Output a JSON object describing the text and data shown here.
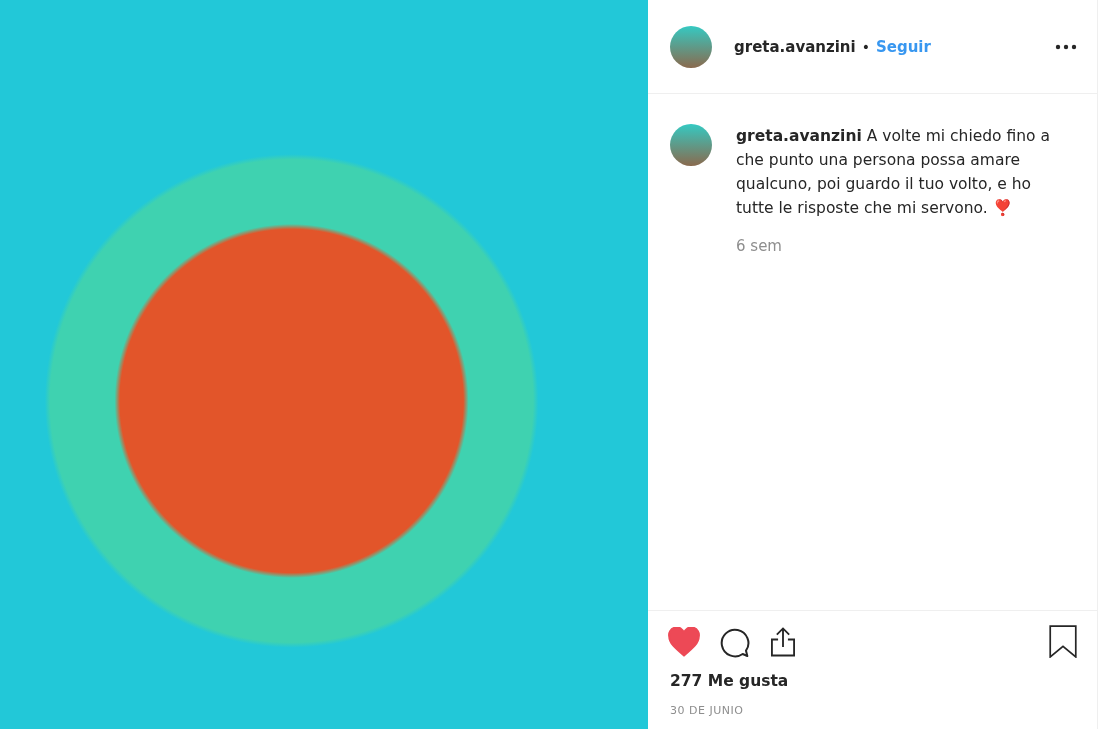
{
  "post": {
    "author": "greta.avanzini",
    "follow_separator": "•",
    "follow": "Seguir",
    "caption": {
      "username": "greta.avanzini",
      "text": "A volte mi chiedo fino a che punto una persona possa amare qualcuno, poi guardo il tuo volto, e ho tutte le risposte che mi servono. ❣️",
      "age": "6 sem"
    },
    "liked": true,
    "saved": false,
    "likes": "277 Me gusta",
    "date": "30 DE JUNIO"
  }
}
